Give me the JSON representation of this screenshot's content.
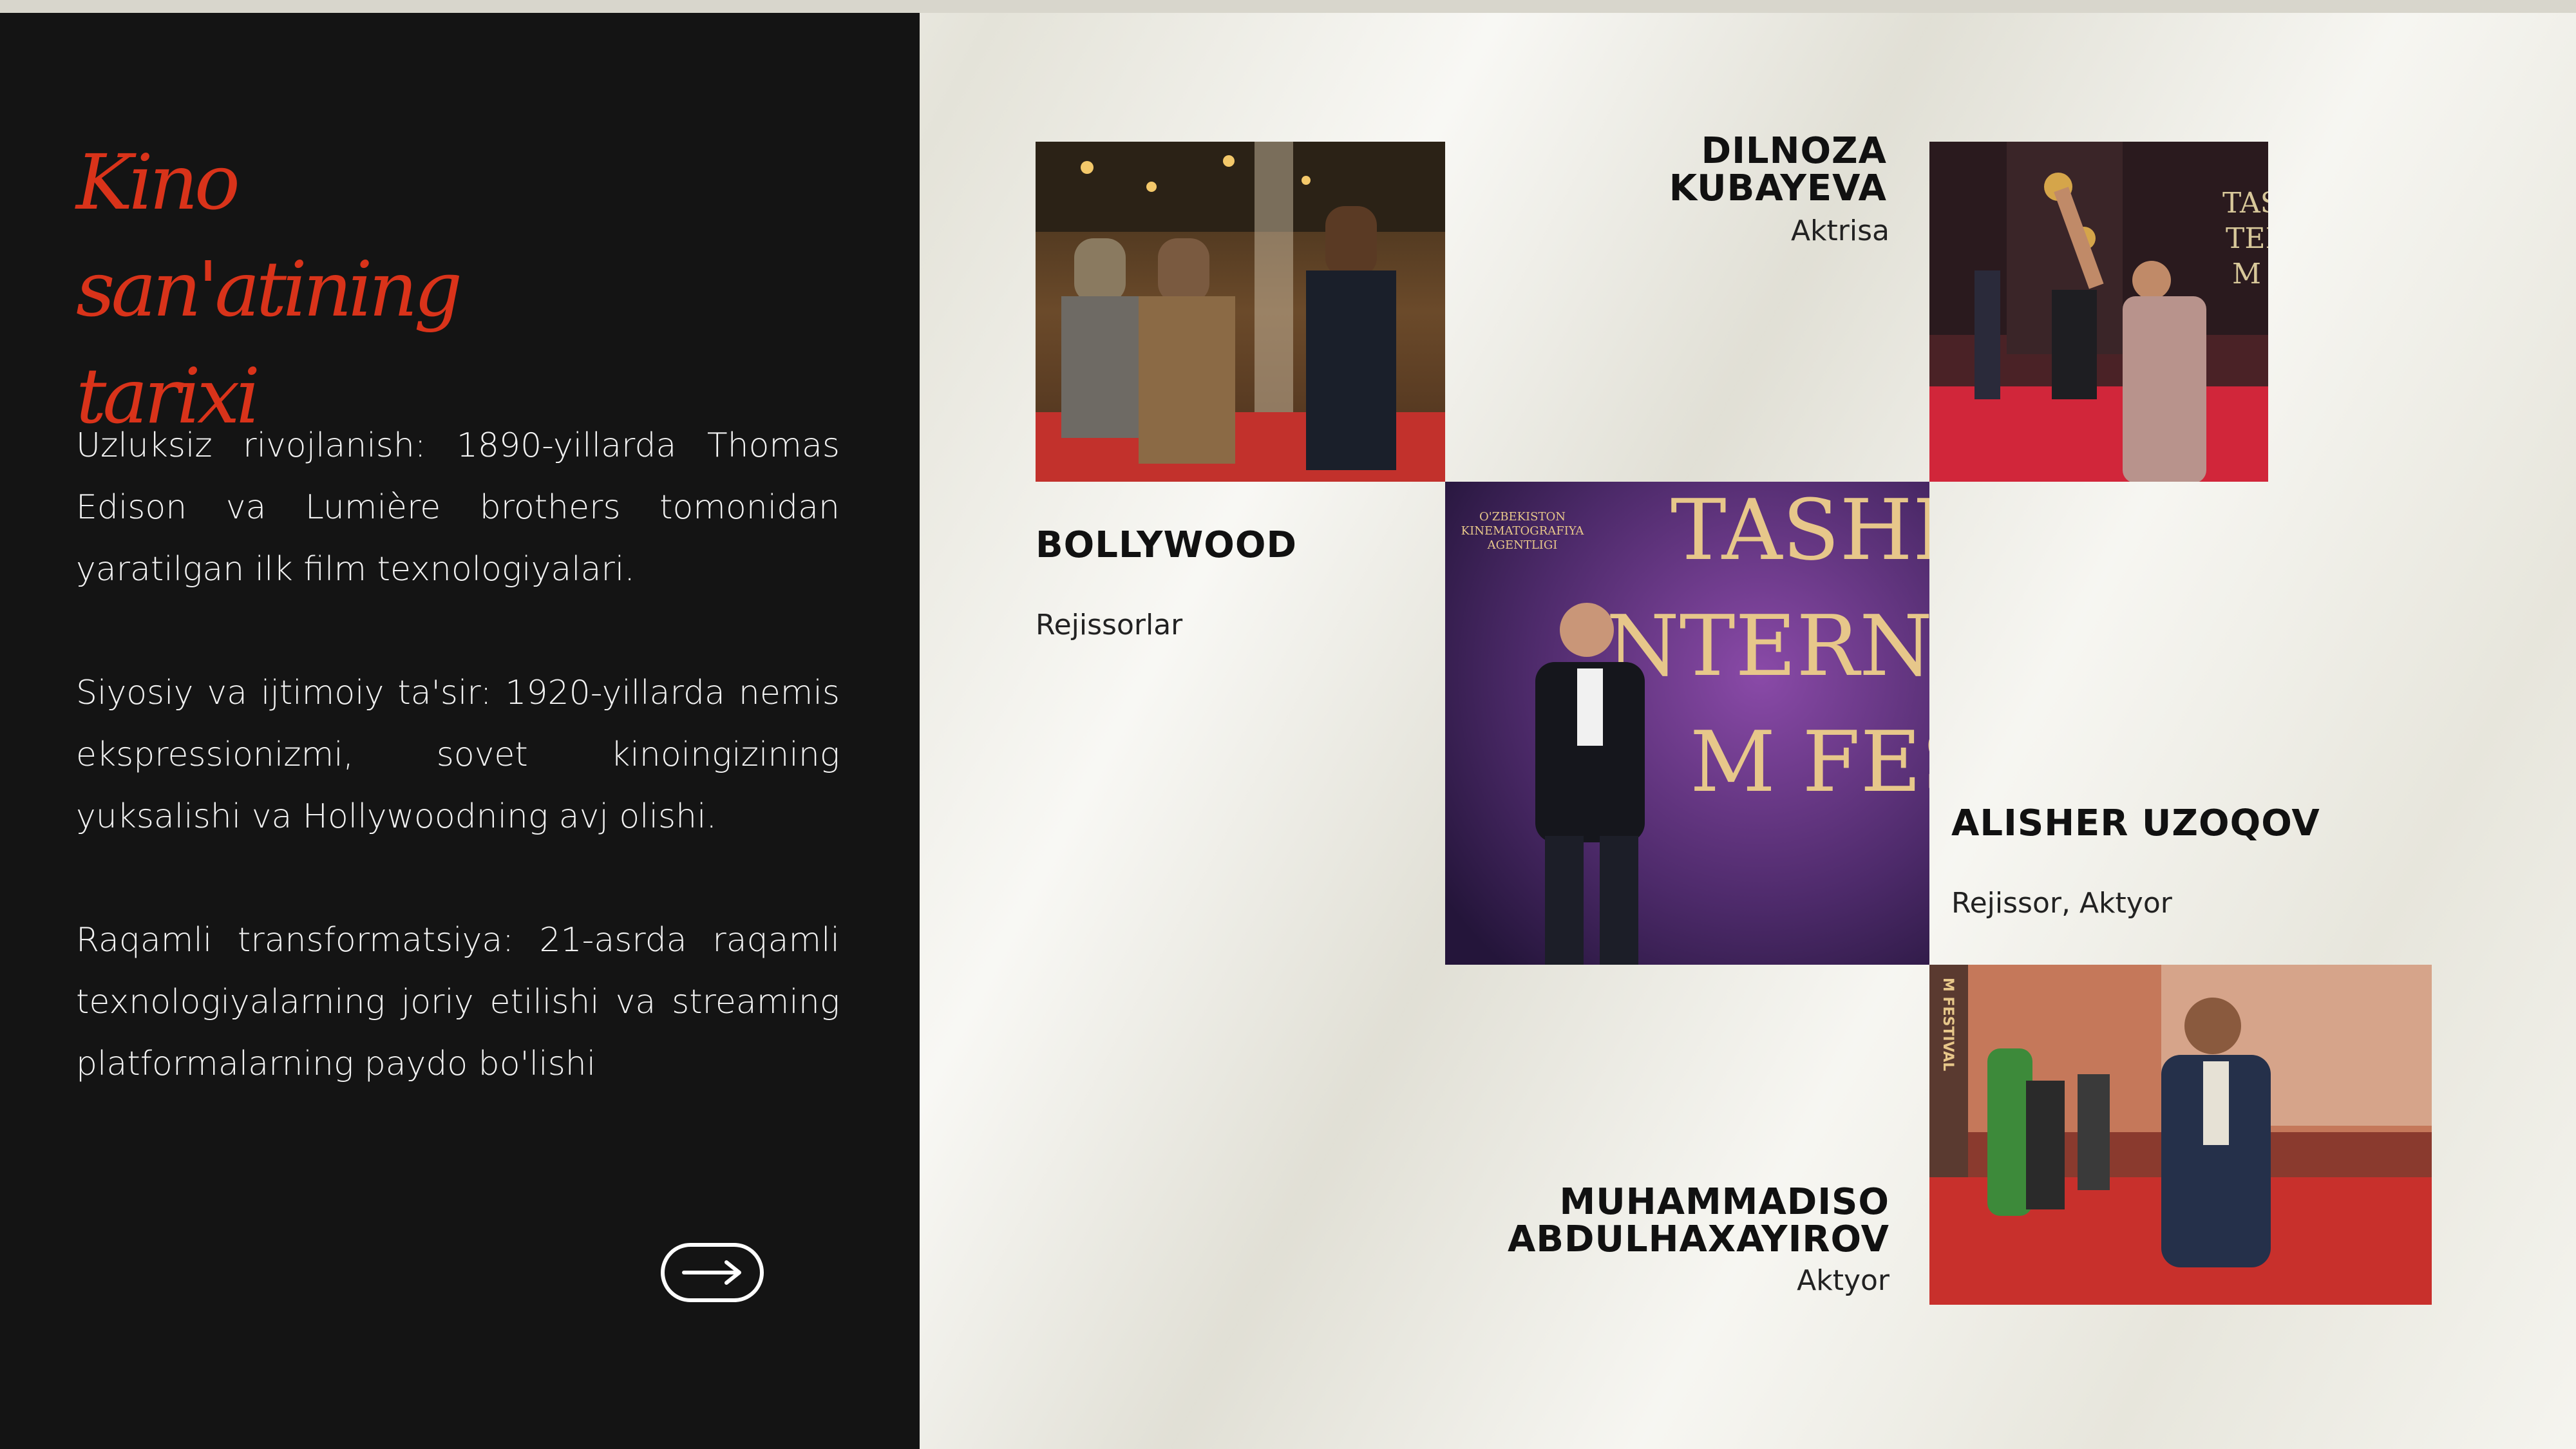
{
  "title": {
    "line1": "Kino san'atining",
    "line2": "tarixi"
  },
  "paragraphs": [
    "Uzluksiz rivojlanish: 1890-yillarda Thomas Edison va Lumière brothers tomonidan yaratilgan ilk film texnologiyalari.",
    "Siyosiy va ijtimoiy ta'sir: 1920-yillarda nemis ekspressionizmi, sovet kinoingizining yuksalishi va Hollywoodning avj olishi.",
    "Raqamli transformatsiya: 21-asrda raqamli texnologiyalarning joriy etilishi va streaming platformalarning paydo bo'lishi"
  ],
  "next_button": {
    "icon": "arrow-right-icon"
  },
  "people": [
    {
      "name": "BOLLYWOOD",
      "role": "Rejissorlar"
    },
    {
      "name": "DILNOZA KUBAYEVA",
      "role": "Aktrisa"
    },
    {
      "name": "ALISHER UZOQOV",
      "role": "Rejissor, Aktyor"
    },
    {
      "name_line1": "MUHAMMADISO",
      "name_line2": "ABDULHAXAYIROV",
      "role": "Aktyor"
    }
  ],
  "photo_signage": {
    "center_wall": [
      "TASHKE",
      "NTERNATI",
      "M FEST"
    ],
    "agency_logo": [
      "O'ZBEKISTON",
      "KINEMATOGRAFIYA",
      "AGENTLIGI"
    ],
    "top_right_wall": [
      "TAS",
      "TER",
      "M"
    ],
    "festival_vertical": "M FESTIVAL"
  },
  "colors": {
    "accent_red": "#d9331a",
    "panel_dark": "#141414",
    "background": "#eeede4"
  }
}
